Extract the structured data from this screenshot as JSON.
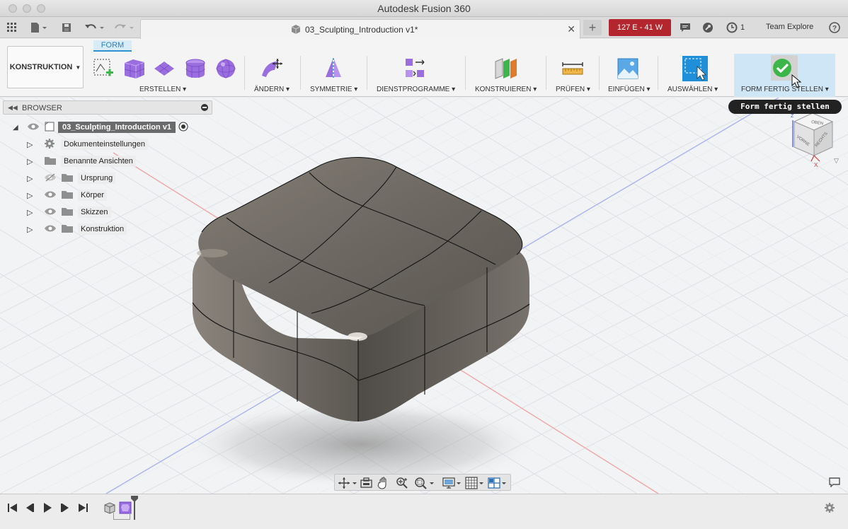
{
  "window": {
    "title": "Autodesk Fusion 360"
  },
  "appbar": {
    "document_tab_title": "03_Sculpting_Introduction v1*",
    "status_badge": "127 E - 41 W",
    "job_count": "1",
    "team_name": "Team Explore",
    "help_label": "?"
  },
  "toolbar": {
    "workspace_label": "KONSTRUKTION",
    "active_tab": "FORM",
    "groups": [
      {
        "label": "ERSTELLEN"
      },
      {
        "label": "ÄNDERN"
      },
      {
        "label": "SYMMETRIE"
      },
      {
        "label": "DIENSTPROGRAMME"
      },
      {
        "label": "KONSTRUIEREN"
      },
      {
        "label": "PRÜFEN"
      },
      {
        "label": "EINFÜGEN"
      },
      {
        "label": "AUSWÄHLEN"
      },
      {
        "label": "FORM FERTIG STELLEN"
      }
    ],
    "tooltip": "Form fertig stellen"
  },
  "browser": {
    "title": "BROWSER",
    "root": "03_Sculpting_Introduction v1",
    "items": [
      {
        "label": "Dokumenteinstellungen",
        "icon": "gear-icon",
        "visible_toggle": false
      },
      {
        "label": "Benannte Ansichten",
        "icon": "folder-icon",
        "visible_toggle": false
      },
      {
        "label": "Ursprung",
        "icon": "folder-icon",
        "visible_toggle": true,
        "hidden": true
      },
      {
        "label": "Körper",
        "icon": "folder-icon",
        "visible_toggle": true
      },
      {
        "label": "Skizzen",
        "icon": "folder-icon",
        "visible_toggle": true
      },
      {
        "label": "Konstruktion",
        "icon": "folder-icon",
        "visible_toggle": true
      }
    ]
  },
  "viewcube": {
    "top": "OBEN",
    "front": "VORNE",
    "right": "RECHTS",
    "axis_x": "X",
    "axis_z": "Z"
  },
  "colors": {
    "accent": "#2f93d1",
    "status_red": "#b3262d",
    "body_gray": "#6e6a64",
    "finish_green": "#3cb54a"
  }
}
